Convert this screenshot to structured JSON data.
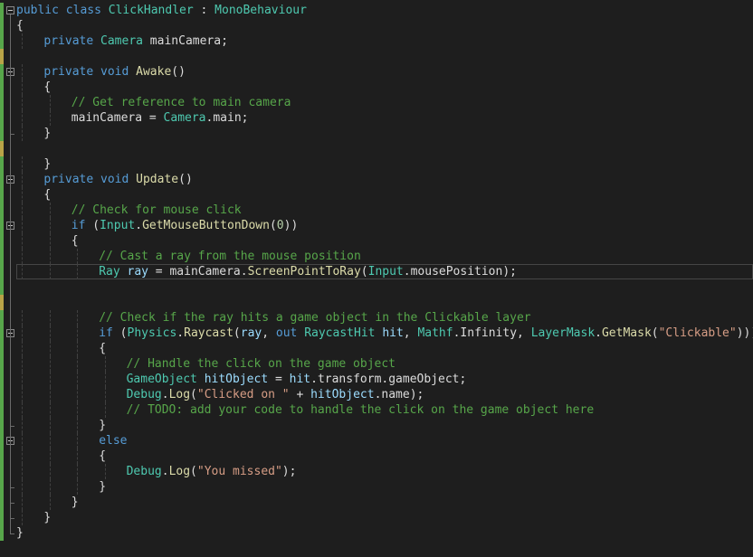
{
  "colors": {
    "background": "#1e1e1e",
    "keyword": "#569cd6",
    "type": "#4ec9b0",
    "method": "#dcdcaa",
    "comment": "#57a64a",
    "string": "#d69d85",
    "number": "#b5cea8",
    "variable": "#9cdcfe",
    "plain": "#dcdcdc",
    "saved_change": "#57a64a",
    "unsaved_change": "#b9a447"
  },
  "editor": {
    "language": "C#",
    "current_line": 18,
    "lines": [
      {
        "indent": 0,
        "fold": "open",
        "change": "saved",
        "tokens": [
          [
            "kw",
            "public"
          ],
          [
            "plain",
            " "
          ],
          [
            "kw",
            "class"
          ],
          [
            "plain",
            " "
          ],
          [
            "cls",
            "ClickHandler"
          ],
          [
            "plain",
            " : "
          ],
          [
            "cls",
            "MonoBehaviour"
          ]
        ]
      },
      {
        "indent": 0,
        "change": "saved",
        "tokens": [
          [
            "plain",
            "{"
          ]
        ]
      },
      {
        "indent": 1,
        "change": "saved",
        "tokens": [
          [
            "kw",
            "private"
          ],
          [
            "plain",
            " "
          ],
          [
            "cls",
            "Camera"
          ],
          [
            "plain",
            " mainCamera;"
          ]
        ]
      },
      {
        "indent": 0,
        "change": "unsaved",
        "tokens": []
      },
      {
        "indent": 1,
        "fold": "open",
        "change": "saved",
        "tokens": [
          [
            "kw",
            "private"
          ],
          [
            "plain",
            " "
          ],
          [
            "kw",
            "void"
          ],
          [
            "plain",
            " "
          ],
          [
            "mth",
            "Awake"
          ],
          [
            "plain",
            "()"
          ]
        ]
      },
      {
        "indent": 1,
        "change": "saved",
        "tokens": [
          [
            "plain",
            "{"
          ]
        ]
      },
      {
        "indent": 2,
        "change": "saved",
        "tokens": [
          [
            "cm",
            "// Get reference to main camera"
          ]
        ]
      },
      {
        "indent": 2,
        "change": "saved",
        "tokens": [
          [
            "plain",
            "mainCamera = "
          ],
          [
            "cls",
            "Camera"
          ],
          [
            "plain",
            "."
          ],
          [
            "plain",
            "main;"
          ]
        ]
      },
      {
        "indent": 1,
        "change": "saved",
        "tokens": [
          [
            "plain",
            "}"
          ]
        ]
      },
      {
        "indent": 0,
        "change": "unsaved",
        "tokens": []
      },
      {
        "indent": 1,
        "change": "saved",
        "tokens": [
          [
            "plain",
            "}"
          ]
        ]
      },
      {
        "indent": 1,
        "fold": "open",
        "change": "saved",
        "tokens": [
          [
            "kw",
            "private"
          ],
          [
            "plain",
            " "
          ],
          [
            "kw",
            "void"
          ],
          [
            "plain",
            " "
          ],
          [
            "mth",
            "Update"
          ],
          [
            "plain",
            "()"
          ]
        ]
      },
      {
        "indent": 1,
        "change": "saved",
        "tokens": [
          [
            "plain",
            "{"
          ]
        ]
      },
      {
        "indent": 2,
        "change": "saved",
        "tokens": [
          [
            "cm",
            "// Check for mouse click"
          ]
        ]
      },
      {
        "indent": 2,
        "fold": "open",
        "change": "saved",
        "tokens": [
          [
            "kw",
            "if"
          ],
          [
            "plain",
            " ("
          ],
          [
            "cls",
            "Input"
          ],
          [
            "plain",
            "."
          ],
          [
            "mth",
            "GetMouseButtonDown"
          ],
          [
            "plain",
            "("
          ],
          [
            "num",
            "0"
          ],
          [
            "plain",
            "))"
          ]
        ]
      },
      {
        "indent": 2,
        "change": "saved",
        "tokens": [
          [
            "plain",
            "{"
          ]
        ]
      },
      {
        "indent": 3,
        "change": "saved",
        "tokens": [
          [
            "cm",
            "// Cast a ray from the mouse position"
          ]
        ]
      },
      {
        "indent": 3,
        "change": "saved",
        "tokens": [
          [
            "cls",
            "Ray"
          ],
          [
            "plain",
            " "
          ],
          [
            "var",
            "ray"
          ],
          [
            "plain",
            " = mainCamera."
          ],
          [
            "mth",
            "ScreenPointToRay"
          ],
          [
            "plain",
            "("
          ],
          [
            "cls",
            "Input"
          ],
          [
            "plain",
            ".mousePosition);"
          ]
        ]
      },
      {
        "indent": 0,
        "change": "saved",
        "tokens": []
      },
      {
        "indent": 0,
        "change": "unsaved",
        "tokens": []
      },
      {
        "indent": 3,
        "change": "saved",
        "tokens": [
          [
            "cm",
            "// Check if the ray hits a game object in the Clickable layer"
          ]
        ]
      },
      {
        "indent": 3,
        "fold": "open",
        "change": "saved",
        "tokens": [
          [
            "kw",
            "if"
          ],
          [
            "plain",
            " ("
          ],
          [
            "cls",
            "Physics"
          ],
          [
            "plain",
            "."
          ],
          [
            "mth",
            "Raycast"
          ],
          [
            "plain",
            "("
          ],
          [
            "var",
            "ray"
          ],
          [
            "plain",
            ", "
          ],
          [
            "kw",
            "out"
          ],
          [
            "plain",
            " "
          ],
          [
            "cls",
            "RaycastHit"
          ],
          [
            "plain",
            " "
          ],
          [
            "var",
            "hit"
          ],
          [
            "plain",
            ", "
          ],
          [
            "cls",
            "Mathf"
          ],
          [
            "plain",
            "."
          ],
          [
            "plain",
            "Infinity, "
          ],
          [
            "cls",
            "LayerMask"
          ],
          [
            "plain",
            "."
          ],
          [
            "mth",
            "GetMask"
          ],
          [
            "plain",
            "("
          ],
          [
            "str",
            "\"Clickable\""
          ],
          [
            "plain",
            ")))"
          ]
        ]
      },
      {
        "indent": 3,
        "change": "saved",
        "tokens": [
          [
            "plain",
            "{"
          ]
        ]
      },
      {
        "indent": 4,
        "change": "saved",
        "tokens": [
          [
            "cm",
            "// Handle the click on the game object"
          ]
        ]
      },
      {
        "indent": 4,
        "change": "saved",
        "tokens": [
          [
            "cls",
            "GameObject"
          ],
          [
            "plain",
            " "
          ],
          [
            "var",
            "hitObject"
          ],
          [
            "plain",
            " = "
          ],
          [
            "var",
            "hit"
          ],
          [
            "plain",
            ".transform.gameObject;"
          ]
        ]
      },
      {
        "indent": 4,
        "change": "saved",
        "tokens": [
          [
            "cls",
            "Debug"
          ],
          [
            "plain",
            "."
          ],
          [
            "mth",
            "Log"
          ],
          [
            "plain",
            "("
          ],
          [
            "str",
            "\"Clicked on \""
          ],
          [
            "plain",
            " + "
          ],
          [
            "var",
            "hitObject"
          ],
          [
            "plain",
            ".name);"
          ]
        ]
      },
      {
        "indent": 4,
        "change": "saved",
        "tokens": [
          [
            "cm",
            "// TODO: add your code to handle the click on the game object here"
          ]
        ]
      },
      {
        "indent": 3,
        "change": "saved",
        "tokens": [
          [
            "plain",
            "}"
          ]
        ]
      },
      {
        "indent": 3,
        "fold": "open",
        "change": "saved",
        "tokens": [
          [
            "kw",
            "else"
          ]
        ]
      },
      {
        "indent": 3,
        "change": "saved",
        "tokens": [
          [
            "plain",
            "{"
          ]
        ]
      },
      {
        "indent": 4,
        "change": "saved",
        "tokens": [
          [
            "cls",
            "Debug"
          ],
          [
            "plain",
            "."
          ],
          [
            "mth",
            "Log"
          ],
          [
            "plain",
            "("
          ],
          [
            "str",
            "\"You missed\""
          ],
          [
            "plain",
            ");"
          ]
        ]
      },
      {
        "indent": 3,
        "change": "saved",
        "tokens": [
          [
            "plain",
            "}"
          ]
        ]
      },
      {
        "indent": 2,
        "change": "saved",
        "tokens": [
          [
            "plain",
            "}"
          ]
        ]
      },
      {
        "indent": 1,
        "change": "saved",
        "tokens": [
          [
            "plain",
            "}"
          ]
        ]
      },
      {
        "indent": 0,
        "change": "saved",
        "tokens": [
          [
            "plain",
            "}"
          ]
        ]
      }
    ]
  }
}
